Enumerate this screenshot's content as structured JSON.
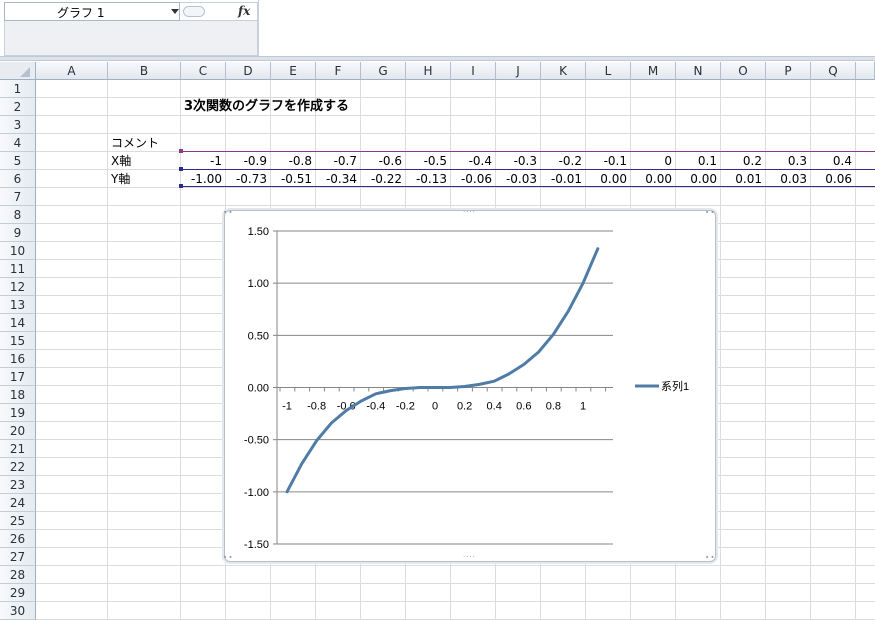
{
  "namebox": {
    "value": "グラフ 1"
  },
  "formula": {
    "fx_label": "fx"
  },
  "columns": [
    "A",
    "B",
    "C",
    "D",
    "E",
    "F",
    "G",
    "H",
    "I",
    "J",
    "K",
    "L",
    "M",
    "N",
    "O",
    "P",
    "Q"
  ],
  "rows": [
    "1",
    "2",
    "3",
    "4",
    "5",
    "6",
    "7",
    "8",
    "9",
    "10",
    "11",
    "12",
    "13",
    "14",
    "15",
    "16",
    "17",
    "18",
    "19",
    "20",
    "21",
    "22",
    "23",
    "24",
    "25",
    "26",
    "27",
    "28",
    "29",
    "30"
  ],
  "sheet": {
    "title": "3次関数のグラフを作成する",
    "comment_label": "コメント",
    "x_label": "X軸",
    "y_label": "Y軸",
    "x_values": [
      "-1",
      "-0.9",
      "-0.8",
      "-0.7",
      "-0.6",
      "-0.5",
      "-0.4",
      "-0.3",
      "-0.2",
      "-0.1",
      "0",
      "0.1",
      "0.2",
      "0.3",
      "0.4"
    ],
    "y_values": [
      "-1.00",
      "-0.73",
      "-0.51",
      "-0.34",
      "-0.22",
      "-0.13",
      "-0.06",
      "-0.03",
      "-0.01",
      "0.00",
      "0.00",
      "0.00",
      "0.01",
      "0.03",
      "0.06"
    ]
  },
  "colors": {
    "series": "#4f7ca6",
    "gridline": "#868686",
    "cell_grid": "#dadcdd",
    "row5_border": "#8b3a8b",
    "row6_border": "#2c2c8c"
  },
  "chart_data": {
    "type": "line",
    "x": [
      -1,
      -0.9,
      -0.8,
      -0.7,
      -0.6,
      -0.5,
      -0.4,
      -0.3,
      -0.2,
      -0.1,
      0,
      0.1,
      0.2,
      0.3,
      0.4,
      0.5,
      0.6,
      0.7,
      0.8,
      0.9,
      1,
      1.1
    ],
    "x_tick_labels": [
      "-1",
      "-0.8",
      "-0.6",
      "-0.4",
      "-0.2",
      "0",
      "0.2",
      "0.4",
      "0.6",
      "0.8",
      "1"
    ],
    "y_tick_labels": [
      "1.50",
      "1.00",
      "0.50",
      "0.00",
      "-0.50",
      "-1.00",
      "-1.50"
    ],
    "series": [
      {
        "name": "系列1",
        "values": [
          -1.0,
          -0.73,
          -0.51,
          -0.34,
          -0.22,
          -0.13,
          -0.06,
          -0.03,
          -0.01,
          0.0,
          0.0,
          0.0,
          0.01,
          0.03,
          0.06,
          0.13,
          0.22,
          0.34,
          0.51,
          0.73,
          1.0,
          1.33
        ]
      }
    ],
    "ylim": [
      -1.5,
      1.5
    ],
    "grid": true,
    "legend": "right"
  }
}
